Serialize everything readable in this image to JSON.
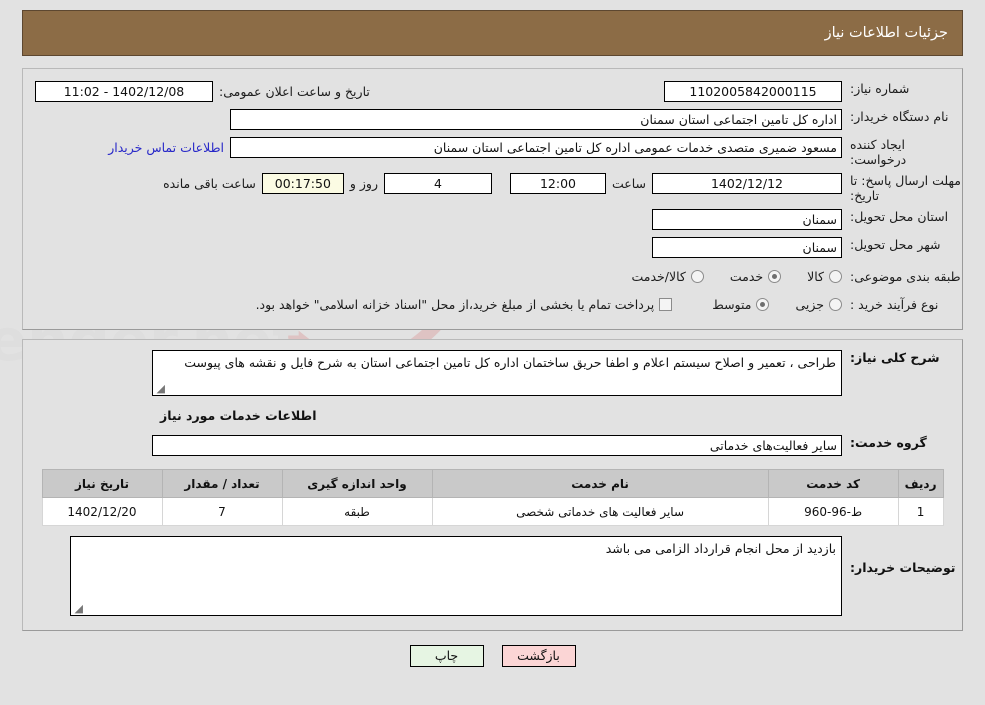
{
  "header": {
    "title": "جزئیات اطلاعات نیاز"
  },
  "form": {
    "need_number_label": "شماره نیاز:",
    "need_number_value": "1102005842000115",
    "public_announce_label": "تاریخ و ساعت اعلان عمومی:",
    "public_announce_value": "1402/12/08 - 11:02",
    "buyer_org_label": "نام دستگاه خریدار:",
    "buyer_org_value": "اداره کل تامین اجتماعی استان سمنان",
    "creator_label": "ایجاد کننده درخواست:",
    "creator_value": "مسعود ضمیری متصدی خدمات عمومی اداره کل تامین اجتماعی استان سمنان",
    "contact_link": "اطلاعات تماس خریدار",
    "deadline_label": "مهلت ارسال پاسخ: تا تاریخ:",
    "deadline_date": "1402/12/12",
    "hour_word": "ساعت",
    "deadline_time": "12:00",
    "days_remaining": "4",
    "days_word": "روز و",
    "time_remaining": "00:17:50",
    "remaining_suffix": "ساعت باقی مانده",
    "province_label": "استان محل تحویل:",
    "province_value": "سمنان",
    "city_label": "شهر محل تحویل:",
    "city_value": "سمنان",
    "category_label": "طبقه بندی موضوعی:",
    "category_options": [
      {
        "label": "کالا",
        "selected": false
      },
      {
        "label": "خدمت",
        "selected": true
      },
      {
        "label": "کالا/خدمت",
        "selected": false
      }
    ],
    "process_label": "نوع فرآیند خرید :",
    "process_options": [
      {
        "label": "جزیی",
        "selected": false
      },
      {
        "label": "متوسط",
        "selected": true
      }
    ],
    "treasury_checkbox_label": "پرداخت تمام یا بخشی از مبلغ خرید،از محل \"اسناد خزانه اسلامی\" خواهد بود.",
    "treasury_checked": false
  },
  "details": {
    "general_desc_label": "شرح کلی نیاز:",
    "general_desc_value": "طراحی ، تعمیر و اصلاح سیستم اعلام و اطفا حریق ساختمان اداره کل تامین اجتماعی استان به شرح فایل و نقشه های پیوست",
    "services_section_title": "اطلاعات خدمات مورد نیاز",
    "service_group_label": "گروه خدمت:",
    "service_group_value": "سایر فعالیت‌های خدماتی",
    "buyer_notes_label": "توضیحات خریدار:",
    "buyer_notes_value": "بازدید از محل انجام قرارداد الزامی می باشد"
  },
  "table": {
    "columns": [
      "ردیف",
      "کد خدمت",
      "نام خدمت",
      "واحد اندازه گیری",
      "تعداد / مقدار",
      "تاریخ نیاز"
    ],
    "rows": [
      {
        "radif": "1",
        "code": "ط-96-960",
        "name": "سایر فعالیت های خدماتی شخصی",
        "unit": "طبقه",
        "qty": "7",
        "date": "1402/12/20"
      }
    ]
  },
  "footer": {
    "print_label": "چاپ",
    "back_label": "بازگشت"
  },
  "colors": {
    "header_bg": "#8c6c46",
    "page_bg": "#e2e2e2",
    "link": "#2727c8",
    "table_header_bg": "#c9c9c9",
    "back_btn_bg": "#fbd5d5",
    "print_btn_bg": "#e6f5e3",
    "highlight_field_bg": "#fbfbe3"
  },
  "watermark": {
    "text": "AnaTender.net"
  }
}
